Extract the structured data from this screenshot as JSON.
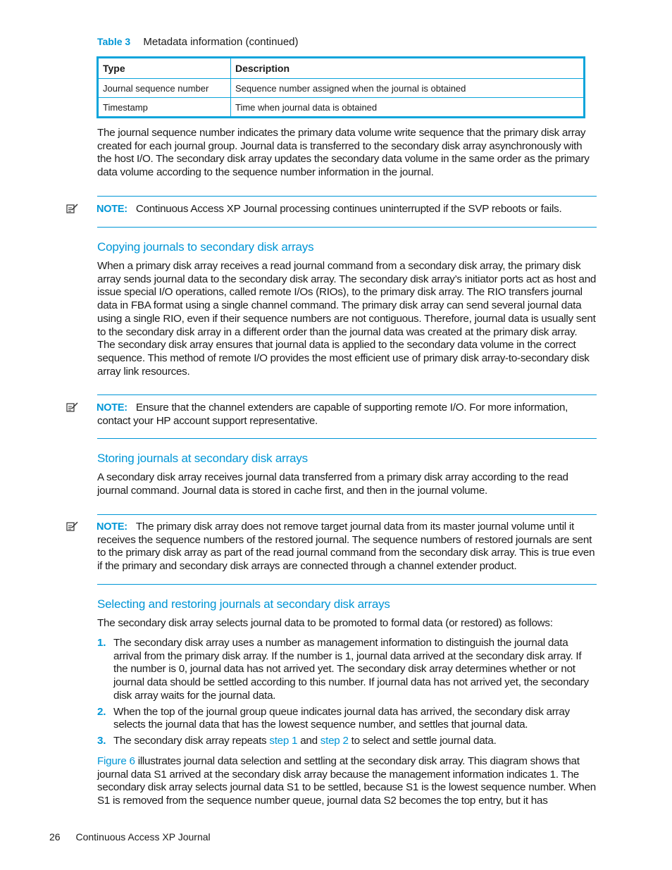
{
  "table": {
    "caption_label": "Table 3",
    "caption_title": "Metadata information (continued)",
    "headers": [
      "Type",
      "Description"
    ],
    "rows": [
      [
        "Journal sequence number",
        "Sequence number assigned when the journal is obtained"
      ],
      [
        "Timestamp",
        "Time when journal data is obtained"
      ]
    ]
  },
  "intro_paragraph": "The journal sequence number indicates the primary data volume write sequence that the primary disk array created for each journal group. Journal data is transferred to the secondary disk array asynchronously with the host I/O. The secondary disk array updates the secondary data volume in the same order as the primary data volume according to the sequence number information in the journal.",
  "notes": [
    {
      "icon": "note-pencil-icon",
      "label": "NOTE:",
      "text": "Continuous Access XP Journal processing continues uninterrupted if the SVP reboots or fails."
    },
    {
      "icon": "note-pencil-icon",
      "label": "NOTE:",
      "text": "Ensure that the channel extenders are capable of supporting remote I/O. For more information, contact your HP account support representative."
    },
    {
      "icon": "note-pencil-icon",
      "label": "NOTE:",
      "text": "The primary disk array does not remove target journal data from its master journal volume until it receives the sequence numbers of the restored journal. The sequence numbers of restored journals are sent to the primary disk array as part of the read journal command from the secondary disk array. This is true even if the primary and secondary disk arrays are connected through a channel extender product."
    }
  ],
  "sections": [
    {
      "heading": "Copying journals to secondary disk arrays",
      "body": "When a primary disk array receives a read journal command from a secondary disk array, the primary disk array sends journal data to the secondary disk array. The secondary disk array’s initiator ports act as host and issue special I/O operations, called remote I/Os (RIOs), to the primary disk array. The RIO transfers journal data in FBA format using a single channel command. The primary disk array can send several journal data using a single RIO, even if their sequence numbers are not contiguous. Therefore, journal data is usually sent to the secondary disk array in a different order than the journal data was created at the primary disk array. The secondary disk array ensures that journal data is applied to the secondary data volume in the correct sequence. This method of remote I/O provides the most efficient use of primary disk array-to-secondary disk array link resources."
    },
    {
      "heading": "Storing journals at secondary disk arrays",
      "body": "A secondary disk array receives journal data transferred from a primary disk array according to the read journal command. Journal data is stored in cache first, and then in the journal volume."
    },
    {
      "heading": "Selecting and restoring journals at secondary disk arrays",
      "body": "The secondary disk array selects journal data to be promoted to formal data (or restored) as follows:",
      "steps": [
        {
          "num": "1.",
          "text": "The secondary disk array uses a number as management information to distinguish the journal data arrival from the primary disk array. If the number is 1, journal data arrived at the secondary disk array. If the number is 0, journal data has not arrived yet. The secondary disk array determines whether or not journal data should be settled according to this number. If journal data has not arrived yet, the secondary disk array waits for the journal data."
        },
        {
          "num": "2.",
          "text": "When the top of the journal group queue indicates journal data has arrived, the secondary disk array selects the journal data that has the lowest sequence number, and settles that journal data."
        },
        {
          "num": "3.",
          "text_before": "The secondary disk array repeats ",
          "link1": "step 1",
          "text_mid": " and ",
          "link2": "step 2",
          "text_after": " to select and settle journal data."
        }
      ],
      "closing": {
        "link": "Figure 6",
        "text": " illustrates journal data selection and settling at the secondary disk array. This diagram shows that journal data S1 arrived at the secondary disk array because the management information indicates 1. The secondary disk array selects journal data S1 to be settled, because S1 is the lowest sequence number. When S1 is removed from the sequence number queue, journal data S2 becomes the top entry, but it has"
      }
    }
  ],
  "footer": {
    "page_number": "26",
    "title": "Continuous Access XP Journal"
  },
  "colors": {
    "accent": "#0096d6",
    "table_border": "#0aa4db",
    "text": "#1a1a1a"
  }
}
